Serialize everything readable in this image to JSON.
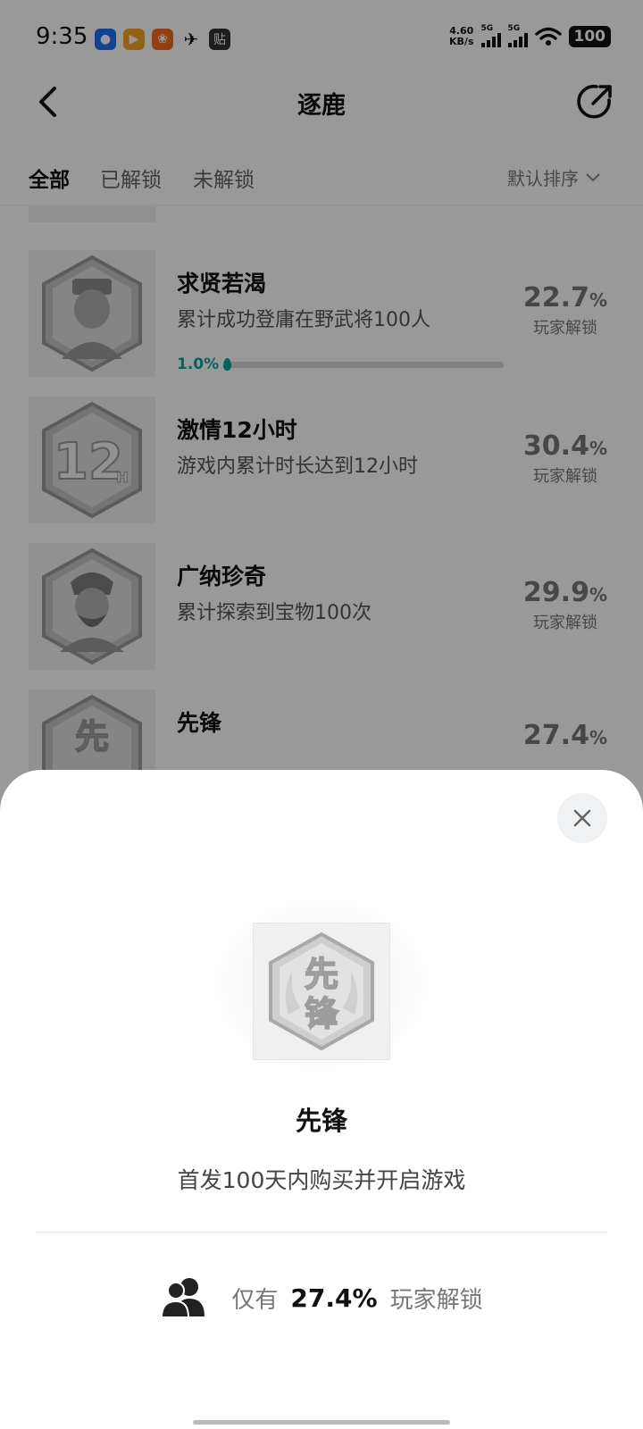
{
  "status_bar": {
    "time": "9:35",
    "net_speed_value": "4.60",
    "net_speed_unit": "KB/s",
    "signal_1": "5G",
    "signal_2": "5G",
    "battery": "100",
    "app_icons": [
      "app-blue-icon",
      "app-video-icon",
      "app-orange-icon",
      "bird-icon",
      "tieba-icon"
    ],
    "tieba_label": "贴"
  },
  "header": {
    "title": "逐鹿"
  },
  "tabs": {
    "items": [
      {
        "label": "全部",
        "active": true
      },
      {
        "label": "已解锁"
      },
      {
        "label": "未解锁"
      }
    ],
    "sort_label": "默认排序"
  },
  "achievements": [
    {
      "title": "求贤若渴",
      "desc": "累计成功登庸在野武将100人",
      "percent": "22.7",
      "unit": "%",
      "label": "玩家解锁",
      "progress_text": "1.0%",
      "progress": 0.01,
      "icon": "official-portrait-badge-icon"
    },
    {
      "title": "激情12小时",
      "desc": "游戏内累计时长达到12小时",
      "percent": "30.4",
      "unit": "%",
      "label": "玩家解锁",
      "icon": "12h-badge-icon"
    },
    {
      "title": "广纳珍奇",
      "desc": "累计探索到宝物100次",
      "percent": "29.9",
      "unit": "%",
      "label": "玩家解锁",
      "icon": "bearded-general-badge-icon"
    },
    {
      "title": "先锋",
      "desc": "",
      "percent": "27.4",
      "unit": "%",
      "label": "玩家解锁",
      "icon": "xianfeng-badge-icon"
    }
  ],
  "sheet": {
    "title": "先锋",
    "desc": "首发100天内购买并开启游戏",
    "unlock_prefix": "仅有",
    "unlock_value": "27.4%",
    "unlock_suffix": "玩家解锁",
    "badge_glyphs": "先锋"
  },
  "colors": {
    "accent": "#0aa39a",
    "overlay": "rgba(0,0,0,0.40)"
  }
}
